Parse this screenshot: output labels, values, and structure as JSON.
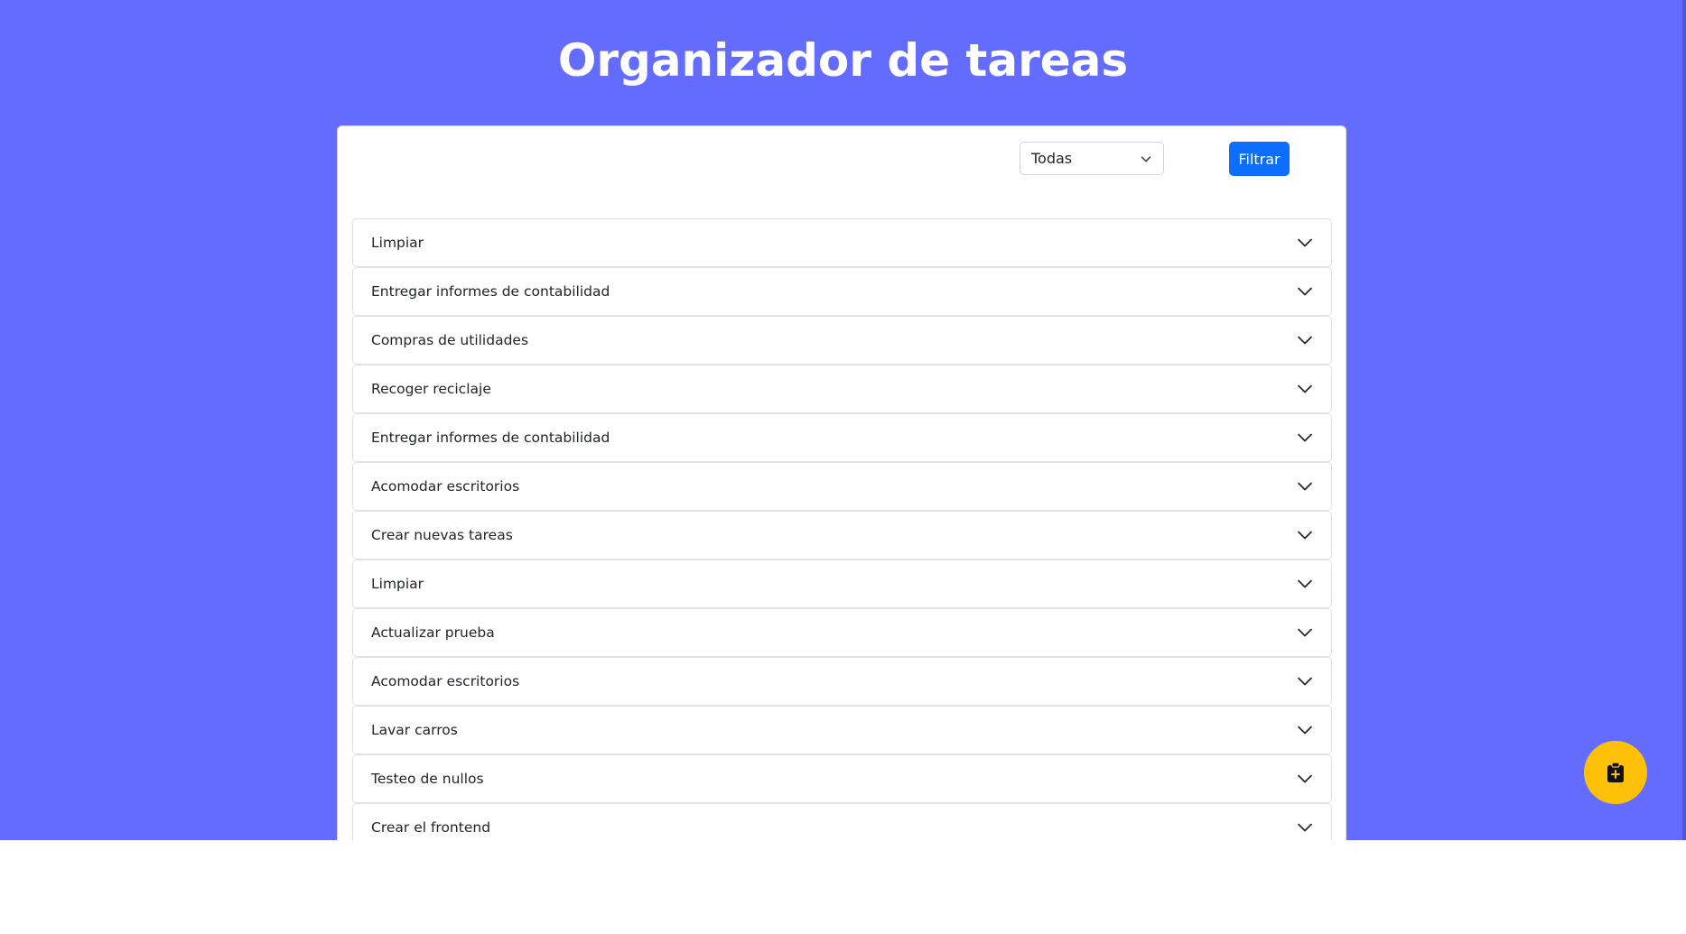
{
  "page": {
    "title": "Organizador de tareas",
    "background_color": "#646cff"
  },
  "filter": {
    "selected_value": "Todas",
    "button_label": "Filtrar",
    "button_color": "#0d6efd"
  },
  "tasks": [
    {
      "label": "Limpiar"
    },
    {
      "label": "Entregar informes de contabilidad"
    },
    {
      "label": "Compras de utilidades"
    },
    {
      "label": "Recoger reciclaje"
    },
    {
      "label": "Entregar informes de contabilidad"
    },
    {
      "label": "Acomodar escritorios"
    },
    {
      "label": "Crear nuevas tareas"
    },
    {
      "label": "Limpiar"
    },
    {
      "label": "Actualizar prueba"
    },
    {
      "label": "Acomodar escritorios"
    },
    {
      "label": "Lavar carros"
    },
    {
      "label": "Testeo de nullos"
    },
    {
      "label": "Crear el frontend"
    }
  ],
  "fab": {
    "icon": "clipboard-plus-icon",
    "color": "#ffc107"
  }
}
